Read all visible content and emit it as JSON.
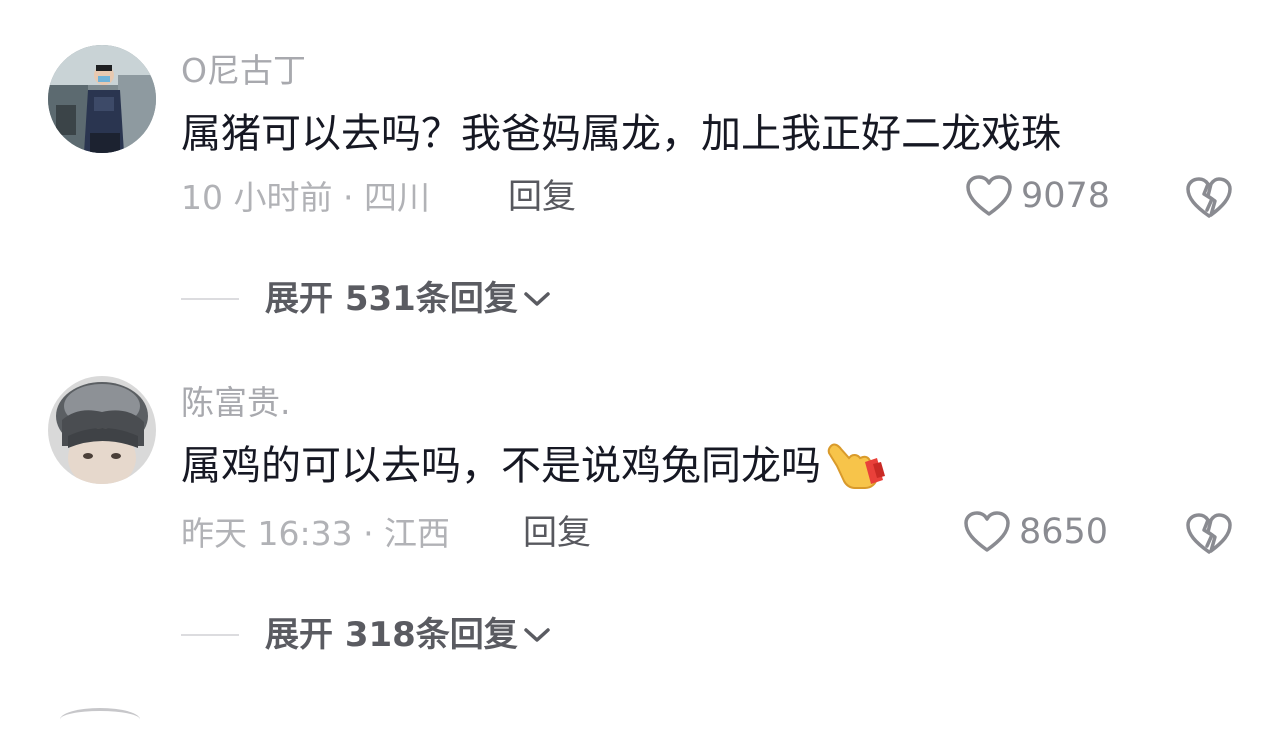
{
  "comments": [
    {
      "username": "O尼古丁",
      "text": "属猪可以去吗？我爸妈属龙，加上我正好二龙戏珠",
      "meta": "10 小时前 · 四川",
      "reply_label": "回复",
      "likes": "9078",
      "expand_label": "展开 531条回复"
    },
    {
      "username": "陈富贵.",
      "text": "属鸡的可以去吗，不是说鸡兔同龙吗",
      "meta": "昨天 16:33 · 江西",
      "reply_label": "回复",
      "likes": "8650",
      "expand_label": "展开 318条回复"
    }
  ],
  "icons": {
    "like": "heart-outline-icon",
    "dislike": "broken-heart-icon",
    "expand": "chevron-down-icon",
    "emoji": "pointing-hand-emoji"
  },
  "colors": {
    "username": "#a8a9ae",
    "text": "#161823",
    "meta": "#b1b2b6",
    "icon": "#8a8b91"
  }
}
